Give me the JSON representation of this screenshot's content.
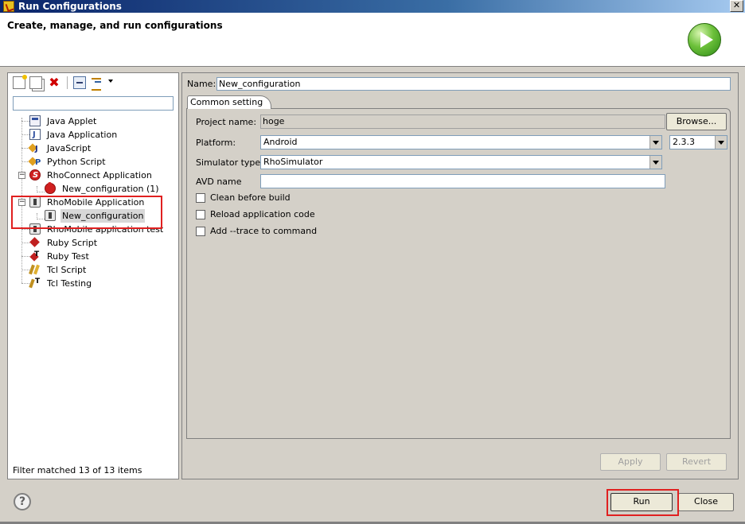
{
  "window": {
    "title": "Run Configurations",
    "close_label": "✕"
  },
  "header": {
    "heading": "Create, manage, and run configurations"
  },
  "left_panel": {
    "filter_placeholder": "",
    "filter_value": "",
    "status": "Filter matched 13 of 13 items",
    "tree": [
      {
        "label": "Java Applet",
        "icon": "java-applet-icon",
        "level": 0
      },
      {
        "label": "Java Application",
        "icon": "java-application-icon",
        "level": 0
      },
      {
        "label": "JavaScript",
        "icon": "javascript-icon",
        "level": 0
      },
      {
        "label": "Python Script",
        "icon": "python-script-icon",
        "level": 0
      },
      {
        "label": "RhoConnect Application",
        "icon": "rhoconnect-icon",
        "level": 0,
        "expanded": true
      },
      {
        "label": "New_configuration (1)",
        "icon": "rhoconnect-icon",
        "level": 1
      },
      {
        "label": "RhoMobile Application",
        "icon": "rhomobile-icon",
        "level": 0,
        "expanded": true
      },
      {
        "label": "New_configuration",
        "icon": "rhomobile-icon",
        "level": 1,
        "selected": true
      },
      {
        "label": "RhoMobile application test",
        "icon": "rhomobile-icon",
        "level": 0
      },
      {
        "label": "Ruby Script",
        "icon": "ruby-script-icon",
        "level": 0
      },
      {
        "label": "Ruby Test",
        "icon": "ruby-test-icon",
        "level": 0
      },
      {
        "label": "Tcl Script",
        "icon": "tcl-script-icon",
        "level": 0
      },
      {
        "label": "Tcl Testing",
        "icon": "tcl-testing-icon",
        "level": 0
      }
    ]
  },
  "config": {
    "name_label": "Name:",
    "name_value": "New_configuration",
    "tab_label": "Common setting",
    "project_label": "Project name:",
    "project_value": "hoge",
    "browse_label": "Browse...",
    "platform_label": "Platform:",
    "platform_value": "Android",
    "version_value": "2.3.3",
    "simulator_label": "Simulator type:",
    "simulator_value": "RhoSimulator",
    "avd_label": "AVD name",
    "avd_value": "",
    "checks": [
      {
        "label": "Clean before build",
        "checked": false
      },
      {
        "label": "Reload application code",
        "checked": false
      },
      {
        "label": "Add --trace to command",
        "checked": false
      }
    ],
    "apply_label": "Apply",
    "revert_label": "Revert"
  },
  "footer": {
    "run_label": "Run",
    "close_label": "Close",
    "help_label": "?"
  },
  "colors": {
    "selection": "#d8d8d8",
    "highlight": "#e02020",
    "dialog": "#d4d0c8"
  }
}
